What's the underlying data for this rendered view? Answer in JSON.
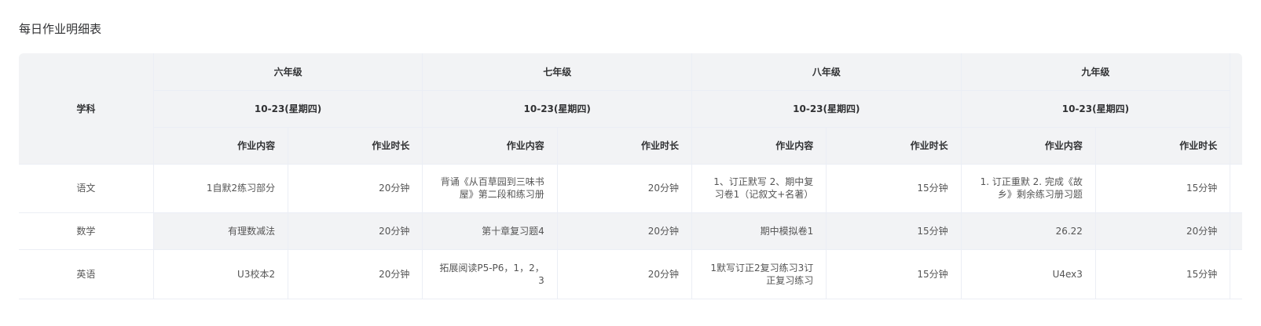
{
  "page": {
    "title": "每日作业明细表"
  },
  "table": {
    "subject_header": "学科",
    "grades": [
      "六年级",
      "七年级",
      "八年级",
      "九年级"
    ],
    "date": "10-23(星期四)",
    "sub_headers": {
      "content": "作业内容",
      "duration": "作业时长"
    },
    "rows": [
      {
        "subject": "语文",
        "cells": [
          {
            "content": "1自默2练习部分",
            "duration": "20分钟"
          },
          {
            "content": "背诵《从百草园到三味书屋》第二段和练习册",
            "duration": "20分钟"
          },
          {
            "content": "1、订正默写 2、期中复习卷1（记叙文+名著）",
            "duration": "15分钟"
          },
          {
            "content": "1. 订正重默 2. 完成《故乡》剩余练习册习题",
            "duration": "15分钟"
          }
        ]
      },
      {
        "subject": "数学",
        "cells": [
          {
            "content": "有理数减法",
            "duration": "20分钟"
          },
          {
            "content": "第十章复习题4",
            "duration": "20分钟"
          },
          {
            "content": "期中模拟卷1",
            "duration": "15分钟"
          },
          {
            "content": "26.22",
            "duration": "20分钟"
          }
        ]
      },
      {
        "subject": "英语",
        "cells": [
          {
            "content": "U3校本2",
            "duration": "20分钟"
          },
          {
            "content": "拓展阅读P5-P6，1，2，3",
            "duration": "20分钟"
          },
          {
            "content": "1默写订正2复习练习3订正复习练习",
            "duration": "15分钟"
          },
          {
            "content": "U4ex3",
            "duration": "15分钟"
          }
        ]
      }
    ]
  }
}
